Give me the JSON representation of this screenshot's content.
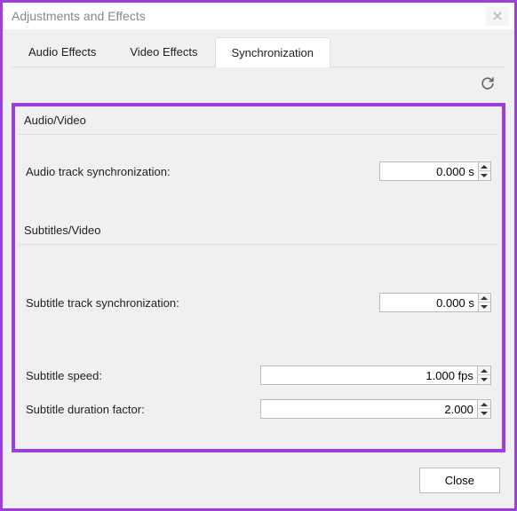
{
  "window": {
    "title": "Adjustments and Effects"
  },
  "tabs": {
    "audio_effects": "Audio Effects",
    "video_effects": "Video Effects",
    "synchronization": "Synchronization",
    "active": "synchronization"
  },
  "sections": {
    "audio_video": {
      "title": "Audio/Video",
      "fields": {
        "audio_sync": {
          "label": "Audio track synchronization:",
          "value": "0.000 s"
        }
      }
    },
    "subtitles_video": {
      "title": "Subtitles/Video",
      "fields": {
        "subtitle_sync": {
          "label": "Subtitle track synchronization:",
          "value": "0.000 s"
        },
        "subtitle_speed": {
          "label": "Subtitle speed:",
          "value": "1.000 fps"
        },
        "subtitle_duration": {
          "label": "Subtitle duration factor:",
          "value": "2.000"
        }
      }
    }
  },
  "footer": {
    "close": "Close"
  },
  "colors": {
    "accent": "#9b3fe0"
  }
}
